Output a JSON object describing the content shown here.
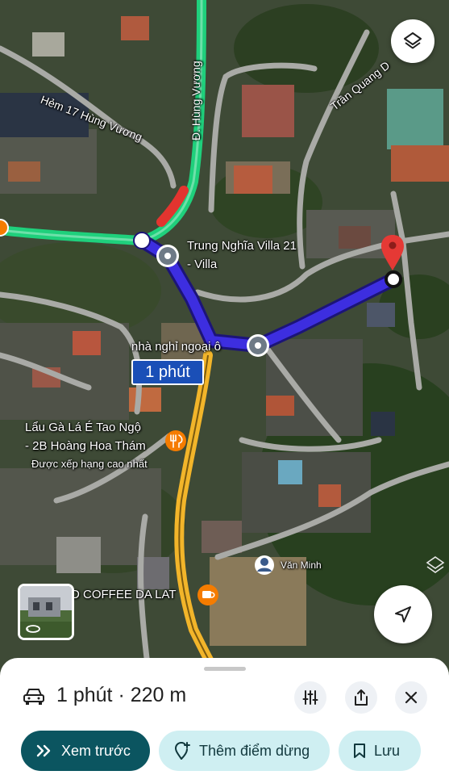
{
  "map": {
    "streets": {
      "hem17": "Hẻm 17 Hùng Vương",
      "hung_vuong": "Đ. Hùng Vương",
      "tran_quang": "Trần Quang D"
    },
    "places": {
      "villa_line1": "Trung Nghĩa Villa 21",
      "villa_line2": "- Villa",
      "nha_nghi": "nhà nghỉ ngoại ô",
      "lau_ga_line1": "Lẩu Gà Lá É Tao Ngộ",
      "lau_ga_line2": "- 2B Hoàng Hoa Thám",
      "lau_ga_rating": "Được xếp hạng cao nhất",
      "coffee": "D COFFEE DA LAT",
      "user_name": "Văn Minh"
    },
    "route_duration_badge": "1 phút",
    "colors": {
      "route": "#3d2ee0",
      "traffic_green": "#1fd07c",
      "traffic_red": "#e3342f",
      "highway_yellow": "#f2b52a",
      "destination_pin": "#e53935",
      "food_poi": "#f57c00"
    },
    "icons": {
      "layers": "layers-icon",
      "navigate": "navigation-arrow-icon",
      "streetview": "streetview-rotate-icon"
    }
  },
  "sheet": {
    "summary": "1 phút · 220 m",
    "buttons": {
      "preview": "Xem trước",
      "add_stop": "Thêm điểm dừng",
      "save": "Lưu"
    },
    "icons": {
      "car": "car-icon",
      "options": "options-sliders-icon",
      "share": "share-icon",
      "close": "close-icon"
    }
  }
}
